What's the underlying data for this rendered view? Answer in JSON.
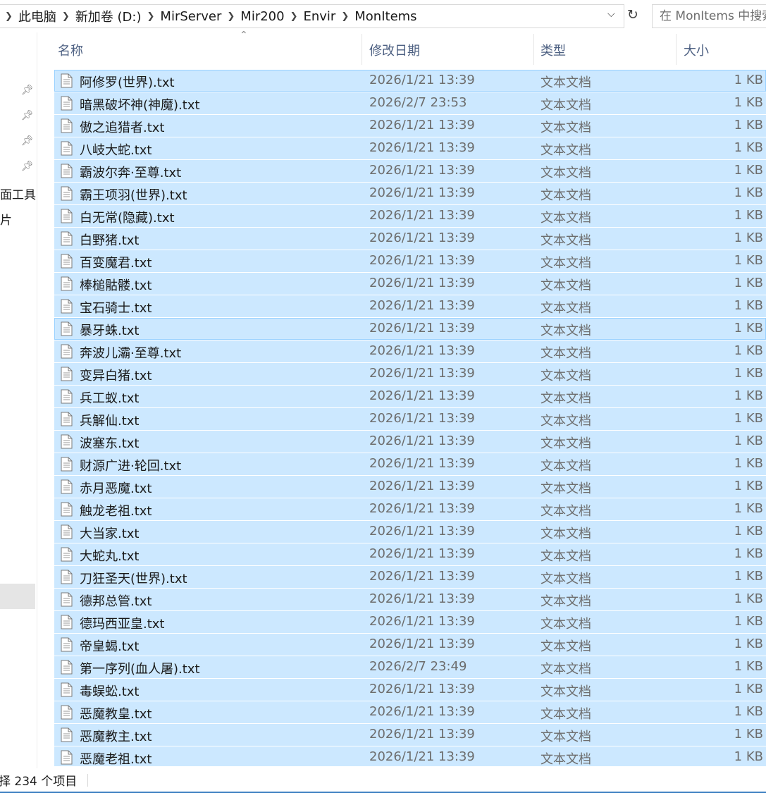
{
  "address_bar": {
    "breadcrumbs": [
      "此电脑",
      "新加卷 (D:)",
      "MirServer",
      "Mir200",
      "Envir",
      "MonItems"
    ],
    "search_placeholder": "在 MonItems 中搜索"
  },
  "nav_pane": {
    "items": [
      "面工具",
      "片"
    ]
  },
  "columns": {
    "name": "名称",
    "date": "修改日期",
    "type": "类型",
    "size": "大小"
  },
  "files": [
    {
      "name": "阿修罗(世界).txt",
      "date": "2026/1/21 13:39",
      "type": "文本文档",
      "size": "1 KB"
    },
    {
      "name": "暗黑破坏神(神魔).txt",
      "date": "2026/2/7 23:53",
      "type": "文本文档",
      "size": "1 KB"
    },
    {
      "name": "傲之追猎者.txt",
      "date": "2026/1/21 13:39",
      "type": "文本文档",
      "size": "1 KB"
    },
    {
      "name": "八岐大蛇.txt",
      "date": "2026/1/21 13:39",
      "type": "文本文档",
      "size": "1 KB"
    },
    {
      "name": "霸波尔奔·至尊.txt",
      "date": "2026/1/21 13:39",
      "type": "文本文档",
      "size": "1 KB"
    },
    {
      "name": "霸王项羽(世界).txt",
      "date": "2026/1/21 13:39",
      "type": "文本文档",
      "size": "1 KB"
    },
    {
      "name": "白无常(隐藏).txt",
      "date": "2026/1/21 13:39",
      "type": "文本文档",
      "size": "1 KB"
    },
    {
      "name": "白野猪.txt",
      "date": "2026/1/21 13:39",
      "type": "文本文档",
      "size": "1 KB"
    },
    {
      "name": "百变魔君.txt",
      "date": "2026/1/21 13:39",
      "type": "文本文档",
      "size": "1 KB"
    },
    {
      "name": "棒槌骷髅.txt",
      "date": "2026/1/21 13:39",
      "type": "文本文档",
      "size": "1 KB"
    },
    {
      "name": "宝石骑士.txt",
      "date": "2026/1/21 13:39",
      "type": "文本文档",
      "size": "1 KB"
    },
    {
      "name": "暴牙蛛.txt",
      "date": "2026/1/21 13:39",
      "type": "文本文档",
      "size": "1 KB"
    },
    {
      "name": "奔波儿灞·至尊.txt",
      "date": "2026/1/21 13:39",
      "type": "文本文档",
      "size": "1 KB"
    },
    {
      "name": "变异白猪.txt",
      "date": "2026/1/21 13:39",
      "type": "文本文档",
      "size": "1 KB"
    },
    {
      "name": "兵工蚁.txt",
      "date": "2026/1/21 13:39",
      "type": "文本文档",
      "size": "1 KB"
    },
    {
      "name": "兵解仙.txt",
      "date": "2026/1/21 13:39",
      "type": "文本文档",
      "size": "1 KB"
    },
    {
      "name": "波塞东.txt",
      "date": "2026/1/21 13:39",
      "type": "文本文档",
      "size": "1 KB"
    },
    {
      "name": "财源广进·轮回.txt",
      "date": "2026/1/21 13:39",
      "type": "文本文档",
      "size": "1 KB"
    },
    {
      "name": "赤月恶魔.txt",
      "date": "2026/1/21 13:39",
      "type": "文本文档",
      "size": "1 KB"
    },
    {
      "name": "触龙老祖.txt",
      "date": "2026/1/21 13:39",
      "type": "文本文档",
      "size": "1 KB"
    },
    {
      "name": "大当家.txt",
      "date": "2026/1/21 13:39",
      "type": "文本文档",
      "size": "1 KB"
    },
    {
      "name": "大蛇丸.txt",
      "date": "2026/1/21 13:39",
      "type": "文本文档",
      "size": "1 KB"
    },
    {
      "name": "刀狂圣天(世界).txt",
      "date": "2026/1/21 13:39",
      "type": "文本文档",
      "size": "1 KB"
    },
    {
      "name": "德邦总管.txt",
      "date": "2026/1/21 13:39",
      "type": "文本文档",
      "size": "1 KB"
    },
    {
      "name": "德玛西亚皇.txt",
      "date": "2026/1/21 13:39",
      "type": "文本文档",
      "size": "1 KB"
    },
    {
      "name": "帝皇蝎.txt",
      "date": "2026/1/21 13:39",
      "type": "文本文档",
      "size": "1 KB"
    },
    {
      "name": "第一序列(血人屠).txt",
      "date": "2026/2/7 23:49",
      "type": "文本文档",
      "size": "1 KB"
    },
    {
      "name": "毒蜈蚣.txt",
      "date": "2026/1/21 13:39",
      "type": "文本文档",
      "size": "1 KB"
    },
    {
      "name": "恶魔教皇.txt",
      "date": "2026/1/21 13:39",
      "type": "文本文档",
      "size": "1 KB"
    },
    {
      "name": "恶魔教主.txt",
      "date": "2026/1/21 13:39",
      "type": "文本文档",
      "size": "1 KB"
    },
    {
      "name": "恶魔老祖.txt",
      "date": "2026/1/21 13:39",
      "type": "文本文档",
      "size": "1 KB"
    }
  ],
  "status_bar": {
    "selection_text": "择 234 个项目"
  }
}
